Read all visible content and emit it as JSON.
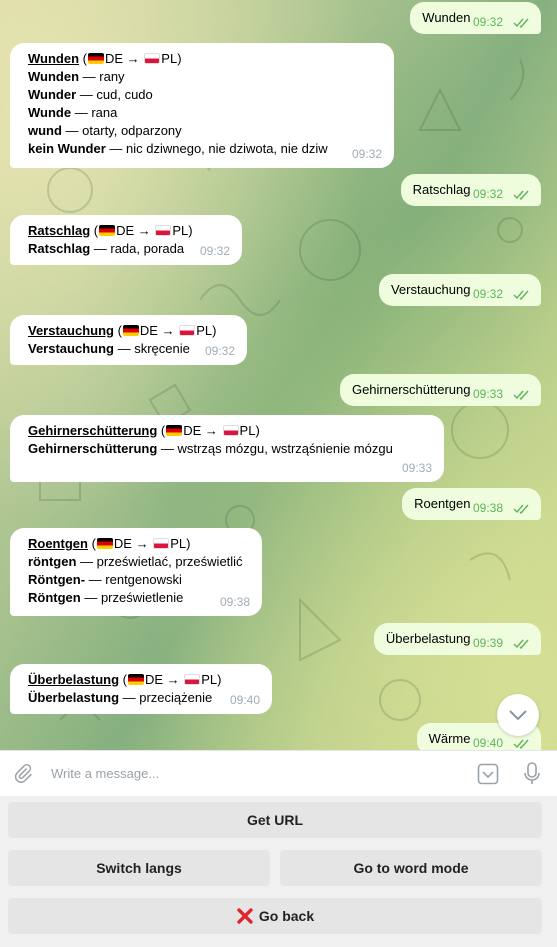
{
  "messages": [
    {
      "dir": "out",
      "text": "Wunden",
      "time": "09:32"
    },
    {
      "dir": "in",
      "word": "Wunden",
      "lang_from": "DE",
      "lang_to": "PL",
      "lines": [
        [
          "Wunden",
          "rany"
        ],
        [
          "Wunder",
          "cud, cudo"
        ],
        [
          "Wunde",
          "rana"
        ],
        [
          "wund",
          "otarty, odparzony"
        ],
        [
          "kein Wunder",
          "nic dziwnego, nie dziwota, nie dziw"
        ]
      ],
      "time": "09:32"
    },
    {
      "dir": "out",
      "text": "Ratschlag",
      "time": "09:32"
    },
    {
      "dir": "in",
      "word": "Ratschlag",
      "lang_from": "DE",
      "lang_to": "PL",
      "lines": [
        [
          "Ratschlag",
          "rada, porada"
        ]
      ],
      "time": "09:32"
    },
    {
      "dir": "out",
      "text": "Verstauchung",
      "time": "09:32"
    },
    {
      "dir": "in",
      "word": "Verstauchung",
      "lang_from": "DE",
      "lang_to": "PL",
      "lines": [
        [
          "Verstauchung",
          "skręcenie"
        ]
      ],
      "time": "09:32"
    },
    {
      "dir": "out",
      "text": "Gehirnerschütterung",
      "time": "09:33"
    },
    {
      "dir": "in",
      "word": "Gehirnerschütterung",
      "lang_from": "DE",
      "lang_to": "PL",
      "lines": [
        [
          "Gehirnerschütterung",
          "wstrząs mózgu, wstrząśnienie mózgu"
        ]
      ],
      "time": "09:33"
    },
    {
      "dir": "out",
      "text": "Roentgen",
      "time": "09:38"
    },
    {
      "dir": "in",
      "word": "Roentgen",
      "lang_from": "DE",
      "lang_to": "PL",
      "lines": [
        [
          "röntgen",
          "prześwietlać, prześwietlić"
        ],
        [
          "Röntgen-",
          "rentgenowski"
        ],
        [
          "Röntgen",
          "prześwietlenie"
        ]
      ],
      "time": "09:38"
    },
    {
      "dir": "out",
      "text": "Überbelastung",
      "time": "09:39"
    },
    {
      "dir": "in",
      "word": "Überbelastung",
      "lang_from": "DE",
      "lang_to": "PL",
      "lines": [
        [
          "Überbelastung",
          "przeciążenie"
        ]
      ],
      "time": "09:40"
    },
    {
      "dir": "out",
      "text": "Wärme",
      "time": "09:40"
    }
  ],
  "composer": {
    "placeholder": "Write a message..."
  },
  "keyboard": {
    "get_url": "Get URL",
    "switch_langs": "Switch langs",
    "word_mode": "Go to word mode",
    "go_back": "Go back"
  },
  "icons": {
    "attach": "paperclip-icon",
    "keyboard": "chevron-down-box-icon",
    "mic": "microphone-icon",
    "scroll": "chevron-down-icon",
    "close": "red-x-icon"
  },
  "colors": {
    "out_bubble": "#effdde",
    "in_bubble": "#ffffff",
    "out_time": "#5eb35a",
    "in_time": "#a0acb6",
    "cancel_red": "#e0262d"
  }
}
